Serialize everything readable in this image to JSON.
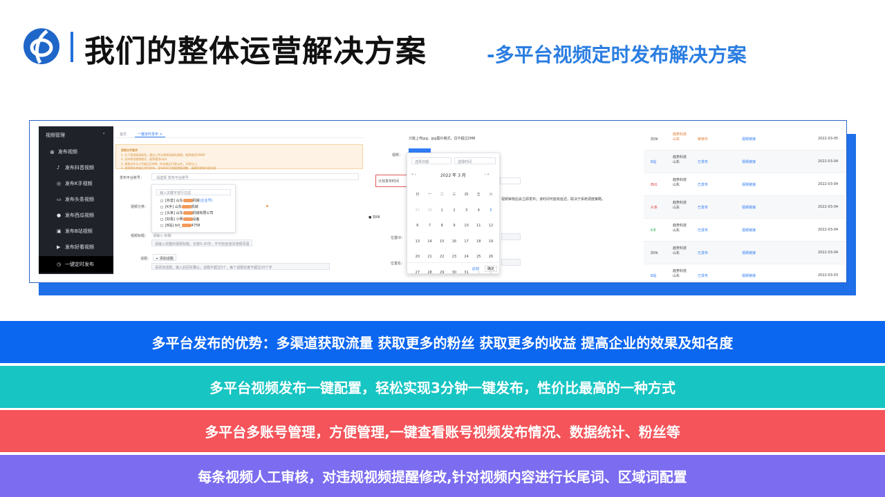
{
  "header": {
    "title": "我们的整体运营解决方案",
    "subtitle": "-多平台视频定时发布解决方案"
  },
  "screenshot": {
    "sidebar": {
      "items": [
        {
          "label": "视频管理"
        },
        {
          "label": "发布视频"
        },
        {
          "label": "发布抖音视频"
        },
        {
          "label": "发布K手视频"
        },
        {
          "label": "发布头条视频"
        },
        {
          "label": "发布西瓜视频"
        },
        {
          "label": "发布B站视频"
        },
        {
          "label": "发布好看视频"
        },
        {
          "label": "一键定时发布"
        }
      ]
    },
    "tabs": [
      "首页",
      "一键定时发布 ×"
    ],
    "warning": {
      "title": "视频文件要求",
      "lines": [
        "1. 为了获得高清体验，建议上传分辨率较高的视频，推荐使用1080P",
        "2. 支持常用视频格式，推荐使用mp4",
        "3. 视频文件大小不超过128M，时长建议15秒以内，10秒以上",
        "4. 视频将在审核后定时发布，发布时间可根据需要调整，请确保视频内容合规"
      ]
    },
    "form": {
      "account_label": "发布平台账号：",
      "account_placeholder": "请选择 发布平台账号",
      "category_label": "视频分类：",
      "video_title_label": "视频标题：",
      "video_title_placeholder": "请输入 标题",
      "title_hint": "请输入完整的视频标题，长度5-30字，不可包含违法违规词语",
      "topic_label": "话题：",
      "topic_button": "+ 添加话题",
      "topic_hint": "请添加话题，输入后回车确认，话题不超过5个，每个话题长度不超过20个字"
    },
    "dropdown": {
      "search_placeholder": "输入关键字进行过滤",
      "options": [
        {
          "platform": "[抖音] 山东",
          "suffix": "机械",
          "tag": "(企业号)"
        },
        {
          "platform": "[K手] 山东",
          "suffix": "机械",
          "tag": ""
        },
        {
          "platform": "[头条] 山东",
          "suffix": "机械有限公司",
          "tag": ""
        },
        {
          "platform": "[好看] 小明",
          "suffix": "设备",
          "tag": ""
        },
        {
          "platform": "[B站] bili_",
          "suffix": "4758",
          "tag": ""
        }
      ]
    },
    "center": {
      "upload_hint": "只能上传jpg、jpg图片格式，且不超过2MB",
      "video_label": "视频：",
      "schedule_label": "计划发布时间",
      "note": "视频审核后会立即发布；该时间可能有延迟，取决于系统调度策略。",
      "douyin_label": "抖IN",
      "location_id_label": "位置ID：",
      "location_name_label": "位置名："
    },
    "calendar": {
      "start_placeholder": "选择日期",
      "end_placeholder": "选择时间",
      "month_label": "2022 年  3 月",
      "weekdays": [
        "日",
        "一",
        "二",
        "三",
        "四",
        "五",
        "六"
      ],
      "days": [
        [
          "27",
          "28",
          "1",
          "2",
          "3",
          "4",
          "5"
        ],
        [
          "6",
          "7",
          "8",
          "9",
          "10",
          "11",
          "12"
        ],
        [
          "13",
          "14",
          "15",
          "16",
          "17",
          "18",
          "19"
        ],
        [
          "20",
          "21",
          "22",
          "23",
          "24",
          "25",
          "26"
        ],
        [
          "27",
          "28",
          "29",
          "30",
          "31",
          "1",
          "2"
        ],
        [
          "3",
          "4",
          "5",
          "6",
          "7",
          "8",
          "9"
        ]
      ],
      "clear_label": "此刻",
      "ok_label": "确定"
    },
    "table": {
      "rows": [
        {
          "platform": "抖IN",
          "company": "趋势科技\n山东",
          "status": "审核中",
          "link": "视频链接",
          "date": "2022-03-05"
        },
        {
          "platform": "B站",
          "company": "趋势科技\n山东",
          "status": "已发布",
          "link": "视频链接",
          "date": "2022-03-04"
        },
        {
          "platform": "西瓜",
          "company": "趋势科技\n山东",
          "status": "已发布",
          "link": "视频链接",
          "date": "2022-03-04"
        },
        {
          "platform": "头条",
          "company": "趋势科技\n山东",
          "status": "已发布",
          "link": "视频链接",
          "date": "2022-03-04"
        },
        {
          "platform": "K手",
          "company": "趋势科技\n山东",
          "status": "已发布",
          "link": "视频链接",
          "date": "2022-03-04"
        },
        {
          "platform": "抖IN",
          "company": "趋势科技\n山东",
          "status": "已发布",
          "link": "视频链接",
          "date": "2022-03-04"
        },
        {
          "platform": "B站",
          "company": "趋势科技\n山东",
          "status": "已发布",
          "link": "视频链接",
          "date": "2022-03-03"
        }
      ]
    }
  },
  "bands": [
    {
      "text": "多平台发布的优势：多渠道获取流量  获取更多的粉丝  获取更多的收益  提高企业的效果及知名度",
      "color": "#0b66f0"
    },
    {
      "text": "多平台视频发布一键配置，轻松实现3分钟一键发布，性价比最高的一种方式",
      "color": "#17c5c3"
    },
    {
      "text": "多平台多账号管理，方便管理,一键查看账号视频发布情况、数据统计、粉丝等",
      "color": "#f4545a"
    },
    {
      "text": "每条视频人工审核，对违规视频提醒修改,针对视频内容进行长尾词、区域词配置",
      "color": "#7b6cf0"
    }
  ],
  "colors": {
    "accent": "#2a7de1",
    "sidebar_bg": "#1f2329"
  }
}
